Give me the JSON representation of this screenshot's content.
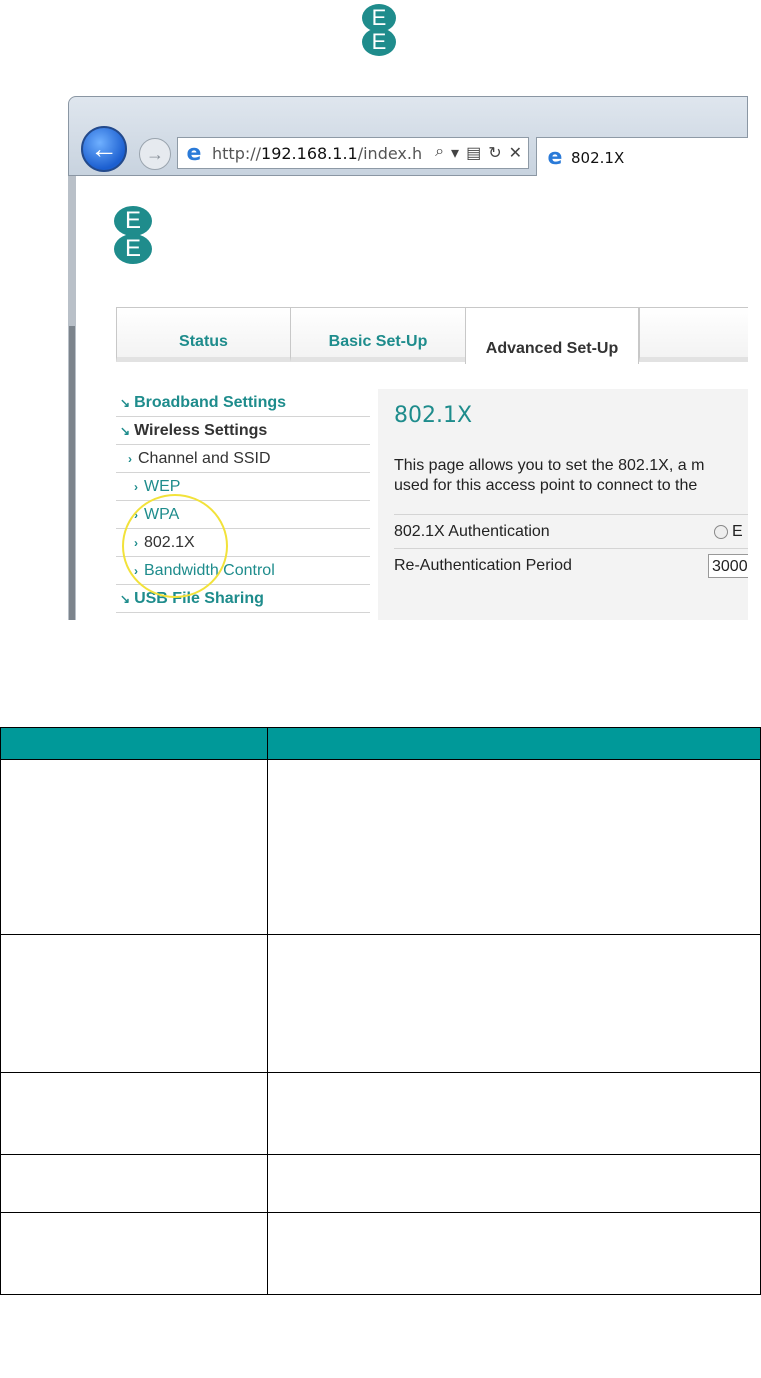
{
  "browser": {
    "url_prefix": "http://",
    "url_host": "192.168.1.1",
    "url_path": "/index.h",
    "tab_title": "802.1X"
  },
  "logo_letters": [
    "E",
    "E"
  ],
  "nav_tabs": [
    "Status",
    "Basic Set-Up",
    "Advanced Set-Up"
  ],
  "sidebar": [
    {
      "label": "Broadband Settings",
      "level": "header"
    },
    {
      "label": "Wireless Settings",
      "level": "header"
    },
    {
      "label": "Channel and SSID",
      "level": "sub"
    },
    {
      "label": "WEP",
      "level": "sub2"
    },
    {
      "label": "WPA",
      "level": "sub2"
    },
    {
      "label": "802.1X",
      "level": "sub2"
    },
    {
      "label": "Bandwidth Control",
      "level": "sub2"
    },
    {
      "label": "USB File Sharing",
      "level": "header"
    }
  ],
  "content": {
    "title": "802.1X",
    "desc_line1": "This page allows you to set the 802.1X, a m",
    "desc_line2": "used for this access point to connect to the",
    "row1_label": "802.1X Authentication",
    "row1_option": "E",
    "row2_label": "Re-Authentication Period",
    "row2_value": "3000"
  },
  "colors": {
    "accent": "#1e8c8c",
    "table_header": "#009999",
    "highlight": "#f2e23a"
  }
}
